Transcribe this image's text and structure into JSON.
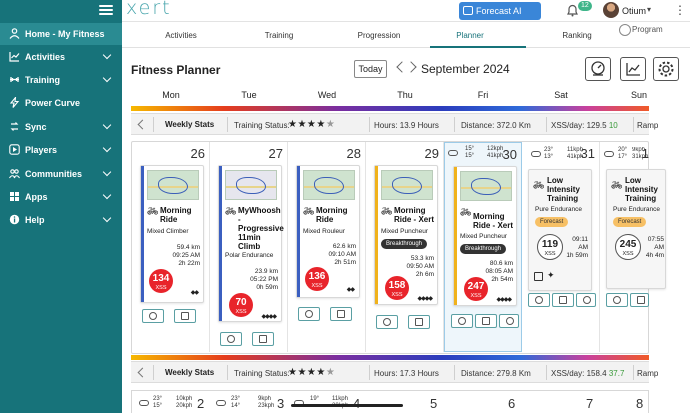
{
  "app": {
    "logo_text": "xert",
    "forecast_ai_label": "Forecast AI Beta",
    "notification_count": "12",
    "user_name": "Otium"
  },
  "sidebar": {
    "items": [
      {
        "label": "Home - My Fitness",
        "icon": "person-icon",
        "active": true,
        "expandable": false
      },
      {
        "label": "Activities",
        "icon": "chart-icon",
        "expandable": true
      },
      {
        "label": "Training",
        "icon": "dumbbell-icon",
        "expandable": true
      },
      {
        "label": "Power Curve",
        "icon": "bolt-icon",
        "expandable": false
      },
      {
        "label": "Sync",
        "icon": "sync-icon",
        "expandable": true
      },
      {
        "label": "Players",
        "icon": "play-icon",
        "expandable": true
      },
      {
        "label": "Communities",
        "icon": "people-icon",
        "expandable": true
      },
      {
        "label": "Apps",
        "icon": "grid-icon",
        "expandable": true
      },
      {
        "label": "Help",
        "icon": "info-icon",
        "expandable": true
      }
    ]
  },
  "tabs": [
    {
      "label": "Activities"
    },
    {
      "label": "Training"
    },
    {
      "label": "Progression"
    },
    {
      "label": "Planner",
      "active": true
    },
    {
      "label": "Ranking"
    },
    {
      "label": "Program"
    }
  ],
  "planner": {
    "title": "Fitness Planner",
    "today_label": "Today",
    "month_label": "September 2024"
  },
  "days": [
    "Mon",
    "Tue",
    "Wed",
    "Thu",
    "Fri",
    "Sat",
    "Sun"
  ],
  "week1_stats": {
    "title": "Weekly Stats",
    "training_status_label": "Training Status:",
    "hours": "Hours: 13.9 Hours",
    "distance": "Distance: 372.0 Km",
    "xss_day_label": "XSS/day: 129.5",
    "xss_day_delta": "10",
    "ramp": "Ramp"
  },
  "week2_stats": {
    "title": "Weekly Stats",
    "training_status_label": "Training Status:",
    "hours": "Hours: 17.3 Hours",
    "distance": "Distance: 279.8 Km",
    "xss_day_label": "XSS/day: 158.4",
    "xss_day_delta": "37.7",
    "ramp": "Ramp"
  },
  "week1": [
    {
      "date": "26",
      "title": "Morning Ride",
      "type": "Mixed Climber",
      "distance": "59.4 km",
      "time": "09:25 AM",
      "duration": "2h 22m",
      "xss": "134",
      "xss_label": "XSS",
      "diamonds": "◆◆",
      "bar": "#3b5fc0"
    },
    {
      "date": "27",
      "title": "MyWhoosh - Progressive 11min Climb",
      "type": "Polar Endurance",
      "distance": "23.9 km",
      "time": "05:22 PM",
      "duration": "0h 59m",
      "xss": "70",
      "xss_label": "XSS",
      "diamonds": "◆◆◆◆",
      "bar": "#3b5fc0"
    },
    {
      "date": "28",
      "title": "Morning Ride",
      "type": "Mixed Rouleur",
      "distance": "62.6 km",
      "time": "09:10 AM",
      "duration": "2h 51m",
      "xss": "136",
      "xss_label": "XSS",
      "diamonds": "◆◆",
      "bar": "#3b5fc0"
    },
    {
      "date": "29",
      "title": "Morning Ride - Xert",
      "type": "Mixed Puncheur",
      "pill": "Breakthrough",
      "distance": "53.3 km",
      "time": "09:50 AM",
      "duration": "2h 6m",
      "xss": "158",
      "xss_label": "XSS",
      "diamonds": "◆◆◆◆",
      "bar": "#f0b21c"
    },
    {
      "date": "30",
      "title": "Morning Ride - Xert",
      "type": "Mixed Puncheur",
      "pill": "Breakthrough",
      "distance": "80.6 km",
      "time": "08:05 AM",
      "duration": "2h 54m",
      "xss": "247",
      "xss_label": "XSS",
      "diamonds": "◆◆◆◆",
      "bar": "#f0b21c",
      "weather": {
        "hi": "15°",
        "lo": "15°",
        "wind": "12kph",
        "gust": "41kph"
      }
    },
    {
      "date": "31",
      "title": "Low Intensity Training",
      "type": "Pure Endurance",
      "pill": "Forecast",
      "time": "09:11 AM",
      "duration": "1h 59m",
      "xss": "119",
      "xss_label": "XSS",
      "bar": "#3b5fc0",
      "weather": {
        "hi": "23°",
        "lo": "13°",
        "wind": "11kph",
        "gust": "41kph"
      }
    },
    {
      "date": "1",
      "title": "Low Intensity Training",
      "type": "Pure Endurance",
      "pill": "Forecast",
      "time": "07:55 AM",
      "duration": "4h 4m",
      "xss": "245",
      "xss_label": "XSS",
      "bar": "#3b5fc0",
      "weather": {
        "hi": "20°",
        "lo": "17°",
        "wind": "9kph",
        "gust": "31kph"
      }
    }
  ],
  "week2": [
    {
      "date": "2",
      "weather": {
        "hi": "23°",
        "lo": "15°",
        "wind": "10kph",
        "gust": "20kph"
      }
    },
    {
      "date": "3",
      "weather": {
        "hi": "23°",
        "lo": "14°",
        "wind": "9kph",
        "gust": "23kph"
      }
    },
    {
      "date": "4",
      "weather": {
        "hi": "19°",
        "lo": "",
        "wind": "11kph",
        "gust": "20kph"
      }
    },
    {
      "date": "5"
    },
    {
      "date": "6"
    },
    {
      "date": "7"
    },
    {
      "date": "8"
    }
  ]
}
